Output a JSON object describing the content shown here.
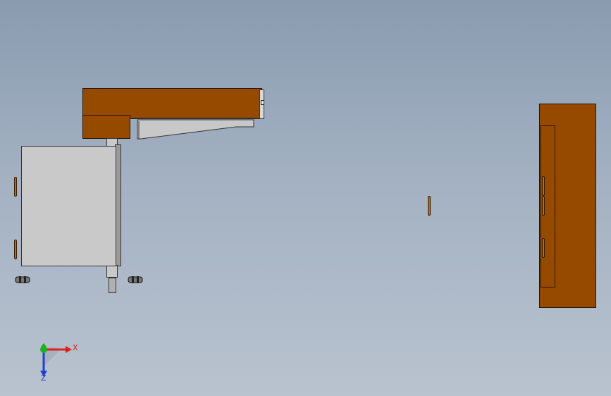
{
  "colors": {
    "wood": "#954a00",
    "wood_edge": "#2a1400",
    "steel": "#c9c9c9",
    "background_top": "#8a9bb0",
    "background_bottom": "#b9c3cf",
    "axis_x": "#e02020",
    "axis_y": "#20b020",
    "axis_z": "#2040d0"
  },
  "triad": {
    "x_label": "X",
    "z_label": "Z",
    "icons": [
      "triad-x-arrow-icon",
      "triad-y-arrow-icon",
      "triad-z-arrow-icon"
    ]
  },
  "parts": [
    "top-arm-wood",
    "support-bracket",
    "steel-cabinet",
    "vertical-shaft",
    "right-wood-panel",
    "center-slot-marker"
  ]
}
